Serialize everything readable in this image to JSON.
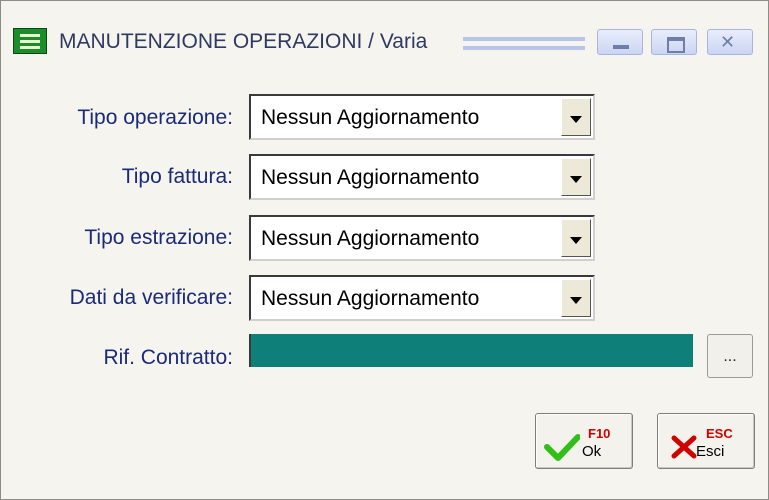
{
  "window": {
    "title": "MANUTENZIONE OPERAZIONI / Varia",
    "controls": {
      "minimize": "minimize-icon",
      "maximize": "maximize-icon",
      "close": "close-icon"
    }
  },
  "form": {
    "rows": [
      {
        "label": "Tipo operazione:",
        "value": "Nessun Aggiornamento"
      },
      {
        "label": "Tipo fattura:",
        "value": "Nessun Aggiornamento"
      },
      {
        "label": "Tipo estrazione:",
        "value": "Nessun Aggiornamento"
      },
      {
        "label": "Dati da verificare:",
        "value": "Nessun Aggiornamento"
      }
    ],
    "contratto": {
      "label": "Rif. Contratto:",
      "value": "",
      "lookup_label": "..."
    }
  },
  "buttons": {
    "ok": {
      "label": "Ok",
      "key": "F10",
      "icon": "check-icon"
    },
    "esci": {
      "label": "Esci",
      "key": "ESC",
      "icon": "x-icon"
    }
  },
  "colors": {
    "label_text": "#1a2a7a",
    "contratto_fill": "#0f7f7a",
    "ok_check": "#2fbf17",
    "esci_x": "#d10000"
  }
}
